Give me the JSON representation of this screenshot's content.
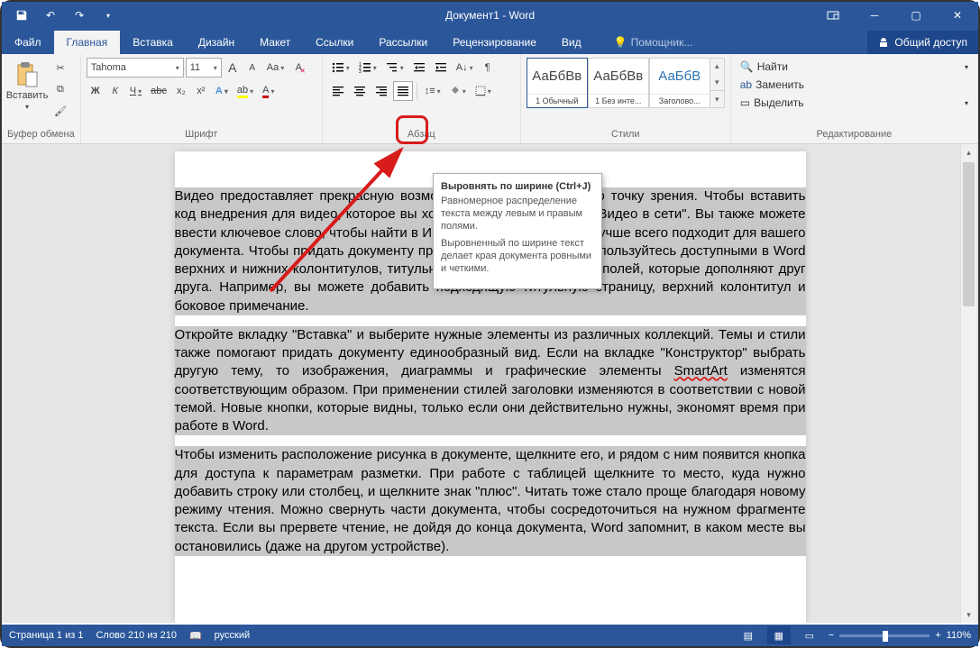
{
  "titlebar": {
    "title": "Документ1 - Word"
  },
  "tabs": {
    "file": "Файл",
    "home": "Главная",
    "insert": "Вставка",
    "design": "Дизайн",
    "layout": "Макет",
    "references": "Ссылки",
    "mailings": "Рассылки",
    "review": "Рецензирование",
    "view": "Вид",
    "tell": "Помощник...",
    "share": "Общий доступ"
  },
  "ribbon": {
    "clipboard": {
      "title": "Буфер обмена",
      "paste": "Вставить"
    },
    "font": {
      "title": "Шрифт",
      "name": "Tahoma",
      "size": "11",
      "bold": "Ж",
      "italic": "К",
      "underline": "Ч",
      "strike": "abc",
      "sub": "x₂",
      "sup": "x²",
      "inc": "A",
      "dec": "A",
      "case": "Aa",
      "clear": "A"
    },
    "paragraph": {
      "title": "Абзац"
    },
    "styles": {
      "title": "Стили",
      "preview": "АаБбВв",
      "preview_heading": "АаБбВ",
      "items": [
        {
          "name": "1 Обычный"
        },
        {
          "name": "1 Без инте..."
        },
        {
          "name": "Заголово..."
        }
      ]
    },
    "editing": {
      "title": "Редактирование",
      "find": "Найти",
      "replace": "Заменить",
      "select": "Выделить"
    }
  },
  "tooltip": {
    "title": "Выровнять по ширине (Ctrl+J)",
    "p1": "Равномерное распределение текста между левым и правым полями.",
    "p2": "Выровненный по ширине текст делает края документа ровными и четкими."
  },
  "document": {
    "para1": "Видео предоставляет прекрасную возможность подтвердить свою точку зрения. Чтобы вставить код внедрения для видео, которое вы хотите добавить, нажмите \"Видео в сети\". Вы также можете ввести ключевое слово, чтобы найти в Интернете видео, которое лучше всего подходит для вашего документа. Чтобы придать документу профессиональный вид, воспользуйтесь доступными в Word верхних и нижних колонтитулов, титульной страницы и текстовых полей, которые дополняют друг друга. Например, вы можете добавить подходящую титульную страницу, верхний колонтитул и боковое примечание.",
    "para2_a": "Откройте вкладку \"Вставка\" и выберите нужные элементы из различных коллекций. Темы и стили также помогают придать документу единообразный вид. Если на вкладке \"Конструктор\" выбрать другую тему, то изображения, диаграммы и графические элементы ",
    "para2_smartart": "SmartArt",
    "para2_b": " изменятся соответствующим образом. При применении стилей заголовки изменяются в соответствии с новой темой. Новые кнопки, которые видны, только если они действительно нужны, экономят время при работе в Word.",
    "para3": "Чтобы изменить расположение рисунка в документе, щелкните его, и рядом с ним появится кнопка для доступа к параметрам разметки. При работе с таблицей щелкните то место, куда нужно добавить строку или столбец, и щелкните знак \"плюс\". Читать тоже стало проще благодаря новому режиму чтения. Можно свернуть части документа, чтобы сосредоточиться на нужном фрагменте текста. Если вы прервете чтение, не дойдя до конца документа, Word запомнит, в каком месте вы остановились (даже на другом устройстве)."
  },
  "statusbar": {
    "page": "Страница 1 из 1",
    "words": "Слово 210 из 210",
    "lang": "русский",
    "zoom": "110%"
  }
}
